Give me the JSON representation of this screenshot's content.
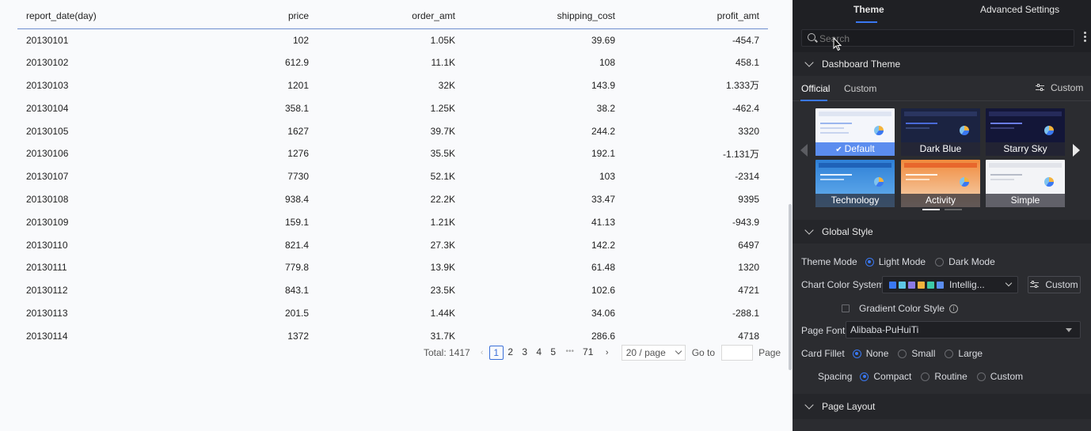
{
  "table": {
    "headers": [
      "report_date(day)",
      "price",
      "order_amt",
      "shipping_cost",
      "profit_amt"
    ],
    "rows": [
      [
        "20130101",
        "102",
        "1.05K",
        "39.69",
        "-454.7"
      ],
      [
        "20130102",
        "612.9",
        "11.1K",
        "108",
        "458.1"
      ],
      [
        "20130103",
        "1201",
        "32K",
        "143.9",
        "1.333万"
      ],
      [
        "20130104",
        "358.1",
        "1.25K",
        "38.2",
        "-462.4"
      ],
      [
        "20130105",
        "1627",
        "39.7K",
        "244.2",
        "3320"
      ],
      [
        "20130106",
        "1276",
        "35.5K",
        "192.1",
        "-1.131万"
      ],
      [
        "20130107",
        "7730",
        "52.1K",
        "103",
        "-2314"
      ],
      [
        "20130108",
        "938.4",
        "22.2K",
        "33.47",
        "9395"
      ],
      [
        "20130109",
        "159.1",
        "1.21K",
        "41.13",
        "-943.9"
      ],
      [
        "20130110",
        "821.4",
        "27.3K",
        "142.2",
        "6497"
      ],
      [
        "20130111",
        "779.8",
        "13.9K",
        "61.48",
        "1320"
      ],
      [
        "20130112",
        "843.1",
        "23.5K",
        "102.6",
        "4721"
      ],
      [
        "20130113",
        "201.5",
        "1.44K",
        "34.06",
        "-288.1"
      ],
      [
        "20130114",
        "1372",
        "31.7K",
        "286.6",
        "4718"
      ]
    ]
  },
  "pagination": {
    "total": "Total: 1417",
    "prev": "‹",
    "pages": [
      "1",
      "2",
      "3",
      "4",
      "5"
    ],
    "active": "1",
    "ellipsis": "•••",
    "last": "71",
    "next": "›",
    "page_size": "20 / page",
    "goto_label": "Go to",
    "page_label": "Page"
  },
  "panel": {
    "tabs": {
      "theme": "Theme",
      "advanced": "Advanced Settings"
    },
    "search_placeholder": "Search",
    "dashboard_theme": {
      "title": "Dashboard Theme",
      "sub_tabs": {
        "official": "Official",
        "custom": "Custom"
      },
      "custom_button": "Custom",
      "themes": [
        "Default",
        "Dark Blue",
        "Starry Sky",
        "Technology",
        "Activity",
        "Simple"
      ],
      "selected": "Default"
    },
    "global_style": {
      "title": "Global Style",
      "theme_mode": {
        "label": "Theme Mode",
        "options": [
          "Light Mode",
          "Dark Mode"
        ],
        "selected": "Light Mode"
      },
      "chart_color": {
        "label": "Chart Color System",
        "value": "Intellig...",
        "custom_button": "Custom",
        "swatches": [
          "#3a78f2",
          "#5ec7e6",
          "#8b7ae6",
          "#f3b33d",
          "#3ec9a7",
          "#5b8def"
        ]
      },
      "gradient": {
        "label": "Gradient Color Style",
        "checked": false
      },
      "page_font": {
        "label": "Page Font",
        "value": "Alibaba-PuHuiTi"
      },
      "card_fillet": {
        "label": "Card Fillet",
        "options": [
          "None",
          "Small",
          "Large"
        ],
        "selected": "None"
      },
      "spacing": {
        "label": "Spacing",
        "options": [
          "Compact",
          "Routine",
          "Custom"
        ],
        "selected": "Compact"
      }
    },
    "page_layout": {
      "title": "Page Layout"
    }
  },
  "colors": {
    "accent": "#3a78f2",
    "panel_bg": "#2b2c30",
    "header_bg": "#1f2024"
  }
}
